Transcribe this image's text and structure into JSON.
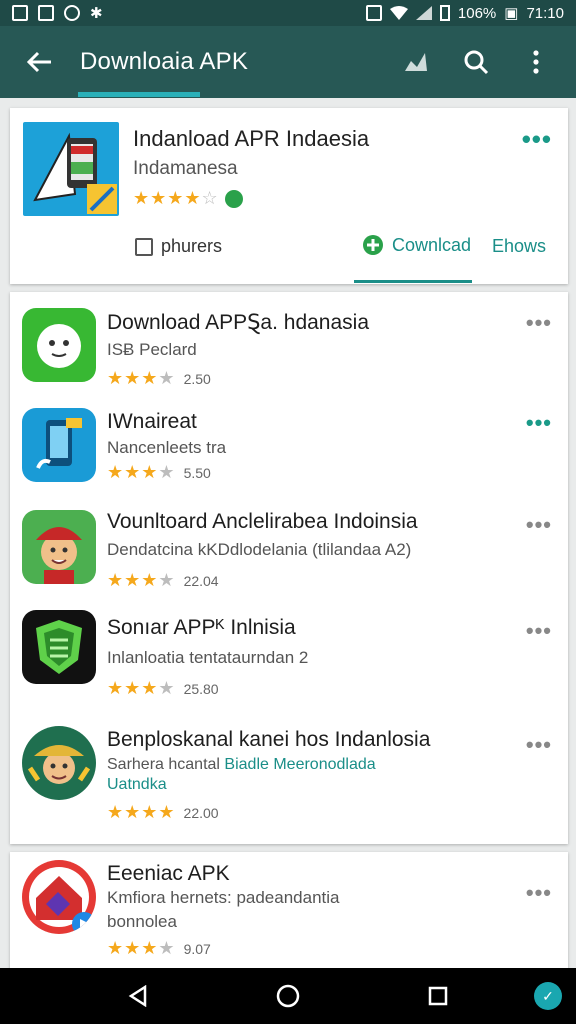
{
  "status_bar": {
    "battery": "106%",
    "time": "71:10"
  },
  "app_bar": {
    "title": "Downloaia APK"
  },
  "featured": {
    "title": "Indanload APR Indaesia",
    "developer": "Indamanesa",
    "checkbox_label": "phurers",
    "download_label": "Cownlcad",
    "show_label": "Ehows"
  },
  "apps": [
    {
      "title": "Download APPⱾa. hdanasia",
      "subtitle": "ISɃ Peclard",
      "rating_count": "2.50",
      "icon": "mascot-icon",
      "rating": 3.5
    },
    {
      "title": "IWnaireat",
      "subtitle": "Nancenleets tra",
      "rating_count": "5.50",
      "icon": "phone-music-icon",
      "rating": 3
    },
    {
      "title": "Vounltoard Anclelirabea Indoinsia",
      "subtitle": "Dendatcina kKDdlodelania (tlilandaa A2)",
      "rating_count": "22.04",
      "icon": "cowboy-avatar-icon",
      "rating": 3.5
    },
    {
      "title": "Sonıar APPᴷ Inlnisia",
      "subtitle": "Inlanloatia tentataurndan 2",
      "rating_count": "25.80",
      "icon": "green-shield-icon",
      "rating": 3.5
    },
    {
      "title": "Benploskanal kanei hos Indanlosia",
      "subtitle_a": "Sarhera hcantal",
      "subtitle_b": "Biadle Meeronodlada",
      "subtitle_c": "Uatndka",
      "rating_count": "22.00",
      "icon": "farmer-avatar-icon",
      "rating": 4
    },
    {
      "title": "Eeeniac APK",
      "subtitle": "Kmfiora hernets: padeandantia",
      "subtitle_2": "bonnolea",
      "rating_count": "9.07",
      "icon": "red-house-icon",
      "rating": 3.5
    }
  ],
  "colors": {
    "app_bar": "#275855",
    "status_bar": "#1f4a47",
    "accent": "#1a8e88",
    "star": "#f5a81c"
  }
}
